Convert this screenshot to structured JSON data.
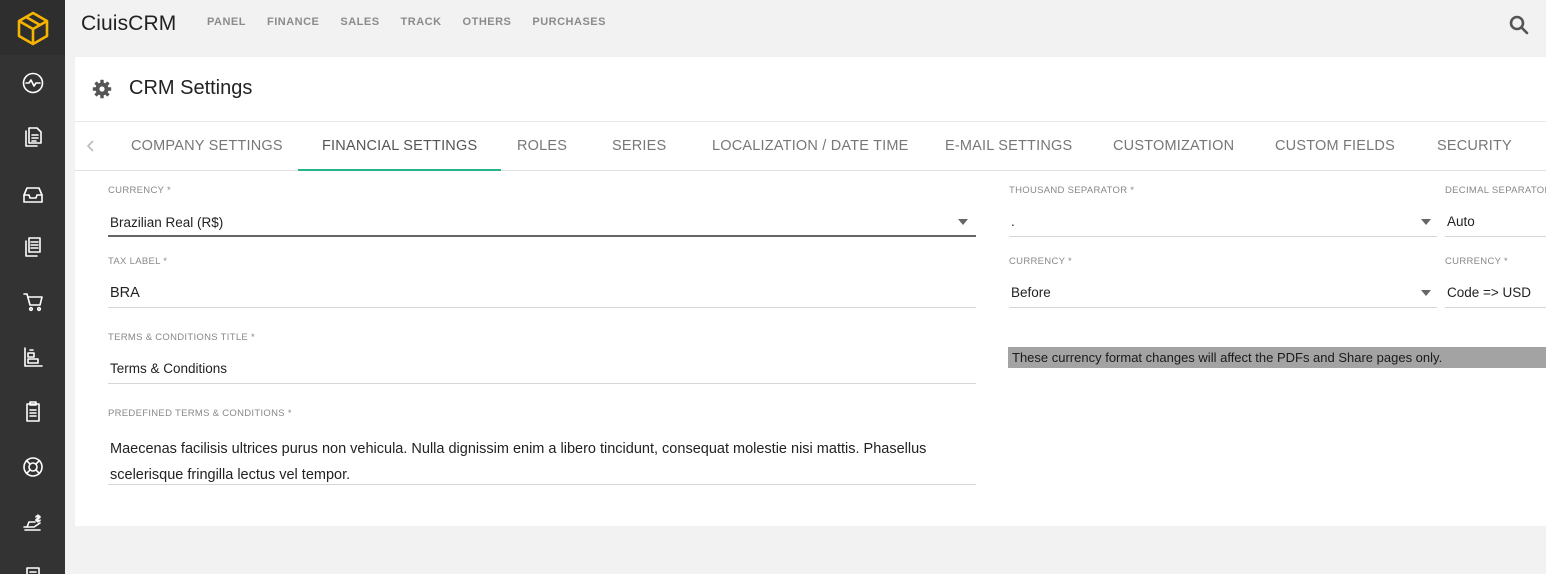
{
  "app": {
    "title": "CiuisCRM"
  },
  "topnav": [
    "PANEL",
    "FINANCE",
    "SALES",
    "TRACK",
    "OTHERS",
    "PURCHASES"
  ],
  "sidebar": {
    "items": [
      "dashboard-pulse-icon",
      "documents-icon",
      "inbox-icon",
      "files-stack-icon",
      "cart-icon",
      "reports-icon",
      "clipboard-icon",
      "support-lifebuoy-icon",
      "expenses-icon",
      "book-icon"
    ]
  },
  "page": {
    "title": "CRM Settings"
  },
  "tabs": [
    {
      "label": "COMPANY SETTINGS",
      "active": false
    },
    {
      "label": "FINANCIAL SETTINGS",
      "active": true
    },
    {
      "label": "ROLES",
      "active": false
    },
    {
      "label": "SERIES",
      "active": false
    },
    {
      "label": "LOCALIZATION / DATE TIME",
      "active": false
    },
    {
      "label": "E-MAIL SETTINGS",
      "active": false
    },
    {
      "label": "CUSTOMIZATION",
      "active": false
    },
    {
      "label": "CUSTOM FIELDS",
      "active": false
    },
    {
      "label": "SECURITY",
      "active": false
    }
  ],
  "form": {
    "currency": {
      "label": "CURRENCY *",
      "value": "Brazilian Real (R$)"
    },
    "tax_label": {
      "label": "TAX LABEL *",
      "value": "BRA"
    },
    "terms_title": {
      "label": "TERMS & CONDITIONS TITLE *",
      "value": "Terms & Conditions"
    },
    "predefined_terms": {
      "label": "PREDEFINED TERMS & CONDITIONS *",
      "line1": "Maecenas facilisis ultrices purus non vehicula. Nulla dignissim enim a libero tincidunt, consequat molestie nisi mattis. Phasellus",
      "line2": "scelerisque fringilla lectus vel tempor."
    },
    "thousand_separator": {
      "label": "THOUSAND SEPARATOR *",
      "value": "."
    },
    "decimal_separator": {
      "label": "DECIMAL SEPARATOR",
      "value": "Auto"
    },
    "currency_position": {
      "label": "CURRENCY *",
      "value": "Before"
    },
    "currency_display": {
      "label": "CURRENCY *",
      "value": "Code => USD"
    },
    "notice": "These currency format changes will affect the PDFs and Share pages only."
  },
  "colors": {
    "sidebar": "#333333",
    "accent": "#26b58a",
    "logo": "#f5b400",
    "notice_bg": "#a3a3a3"
  }
}
